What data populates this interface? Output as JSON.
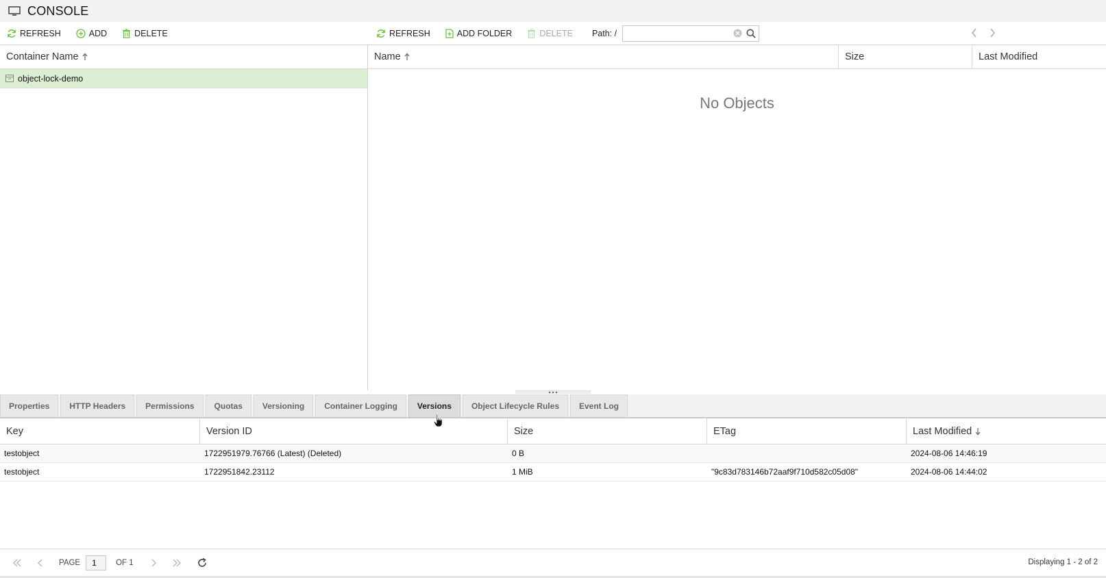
{
  "app": {
    "title": "CONSOLE"
  },
  "left_toolbar": {
    "refresh": "REFRESH",
    "add": "ADD",
    "delete": "DELETE"
  },
  "right_toolbar": {
    "refresh": "REFRESH",
    "add_folder": "ADD FOLDER",
    "delete": "DELETE",
    "path_label": "Path: /",
    "path_value": ""
  },
  "containers": {
    "header": "Container Name",
    "items": [
      {
        "name": "object-lock-demo",
        "selected": true
      }
    ]
  },
  "objects": {
    "headers": {
      "name": "Name",
      "size": "Size",
      "last_modified": "Last Modified"
    },
    "empty_text": "No Objects"
  },
  "tabs": [
    {
      "label": "Properties",
      "active": false
    },
    {
      "label": "HTTP Headers",
      "active": false
    },
    {
      "label": "Permissions",
      "active": false
    },
    {
      "label": "Quotas",
      "active": false
    },
    {
      "label": "Versioning",
      "active": false
    },
    {
      "label": "Container Logging",
      "active": false
    },
    {
      "label": "Versions",
      "active": true
    },
    {
      "label": "Object Lifecycle Rules",
      "active": false
    },
    {
      "label": "Event Log",
      "active": false
    }
  ],
  "versions": {
    "headers": {
      "key": "Key",
      "version_id": "Version ID",
      "size": "Size",
      "etag": "ETag",
      "last_modified": "Last Modified"
    },
    "rows": [
      {
        "key": "testobject",
        "version_id": "1722951979.76766 (Latest) (Deleted)",
        "size": "0 B",
        "etag": "",
        "last_modified": "2024-08-06 14:46:19"
      },
      {
        "key": "testobject",
        "version_id": "1722951842.23112",
        "size": "1 MiB",
        "etag": "\"9c83d783146b72aaf9f710d582c05d08\"",
        "last_modified": "2024-08-06 14:44:02"
      }
    ]
  },
  "paging": {
    "page_label": "PAGE",
    "page_value": "1",
    "of_label": "OF 1",
    "display": "Displaying 1 - 2 of 2"
  },
  "colors": {
    "accent_green": "#6cbf3f",
    "selected_row": "#dcefd2"
  }
}
